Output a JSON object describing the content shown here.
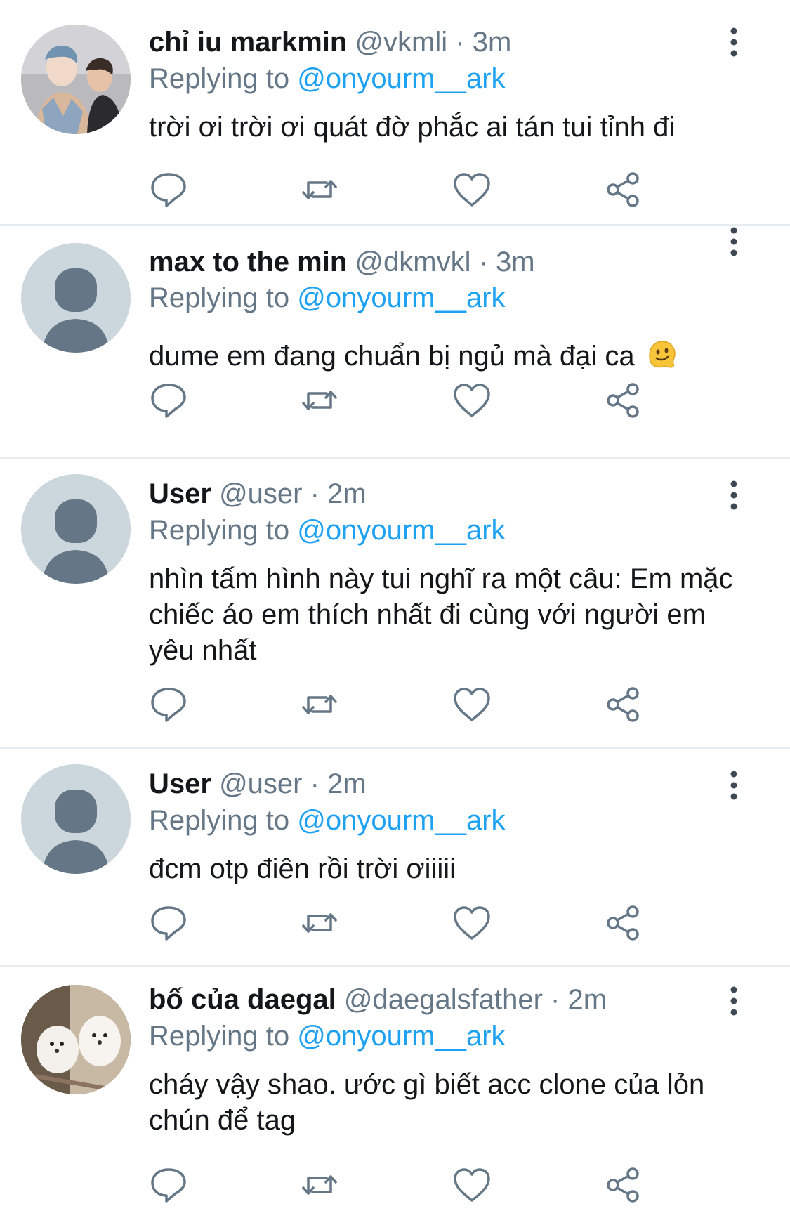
{
  "tweets": [
    {
      "name": "chỉ iu markmin",
      "handle": "@vkmli",
      "sep": "·",
      "time": "3m",
      "replying_prefix": "Replying to",
      "replying_to": "@onyourm__ark",
      "text": "trời ơi trời ơi quát đờ phắc ai tán tui tỉnh đi",
      "avatar": "photo-two-people"
    },
    {
      "name": "max to the min",
      "handle": "@dkmvkl",
      "sep": "·",
      "time": "3m",
      "replying_prefix": "Replying to",
      "replying_to": "@onyourm__ark",
      "text": "dume em đang chuẩn bị ngủ mà đại ca",
      "emoji": "melting-face-emoji",
      "avatar": "default-avatar"
    },
    {
      "name": "User",
      "handle": "@user",
      "sep": "·",
      "time": "2m",
      "replying_prefix": "Replying to",
      "replying_to": "@onyourm__ark",
      "text": "nhìn tấm hình này tui nghĩ ra một câu: Em mặc chiếc áo em thích nhất đi cùng với người em yêu nhất",
      "avatar": "default-avatar"
    },
    {
      "name": "User",
      "handle": "@user",
      "sep": "·",
      "time": "2m",
      "replying_prefix": "Replying to",
      "replying_to": "@onyourm__ark",
      "text": "đcm otp điên rồi trời ơiiiii",
      "avatar": "default-avatar"
    },
    {
      "name": "bố của daegal",
      "handle": "@daegalsfather",
      "sep": "·",
      "time": "2m",
      "replying_prefix": "Replying to",
      "replying_to": "@onyourm__ark",
      "text": "cháy vậy shao. ước gì biết acc clone của lỏn chún để tag",
      "avatar": "photo-white-dogs"
    }
  ],
  "actions": [
    "reply-icon",
    "retweet-icon",
    "like-icon",
    "share-icon"
  ],
  "colors": {
    "name": "#14171a",
    "secondary": "#657786",
    "mention": "#1da1f2",
    "divider": "#e6ecf0",
    "default_avatar_bg": "#ccd6dd",
    "default_avatar_fg": "#657786"
  }
}
